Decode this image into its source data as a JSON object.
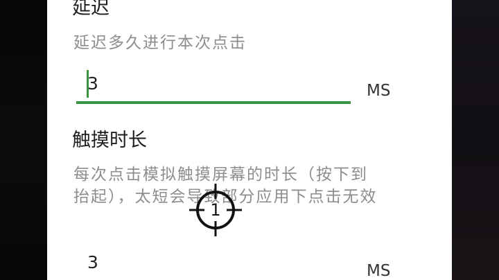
{
  "delay": {
    "title": "延迟",
    "description": "延迟多久进行本次点击",
    "value": "3",
    "unit": "MS"
  },
  "touch_duration": {
    "title": "触摸时长",
    "description": "每次点击模拟触摸屏幕的时长（按下到抬起），太短会导致部分应用下点击无效",
    "value": "3",
    "unit": "MS"
  },
  "overlay": {
    "crosshair_label": "1"
  },
  "colors": {
    "accent": "#3b9440",
    "accent_faint": "#aed3a6"
  }
}
